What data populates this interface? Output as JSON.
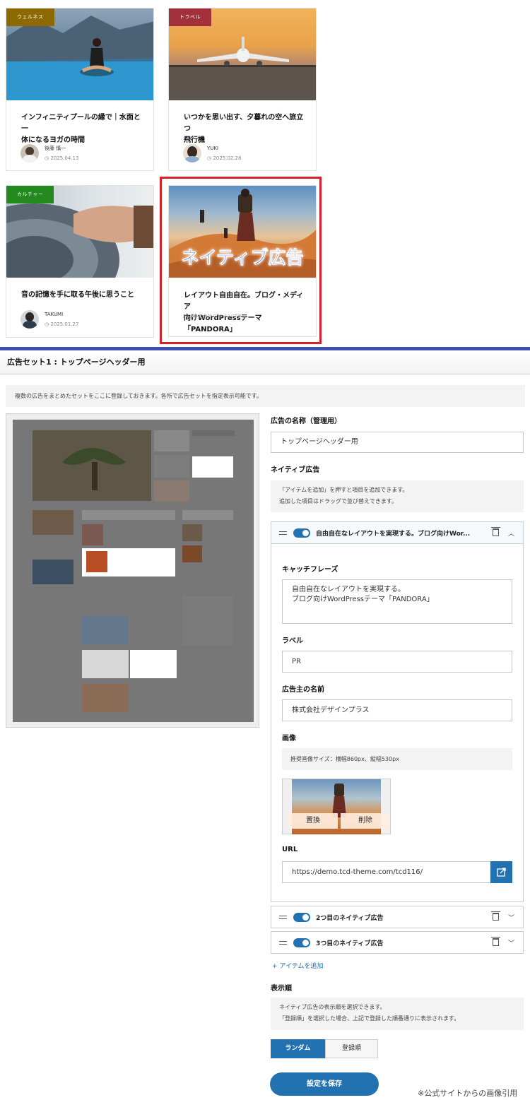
{
  "articles": [
    {
      "category": "ウェルネス",
      "category_color": "#8c6a00",
      "title_line1": "インフィニティプールの縁で｜水面と一",
      "title_line2": "体になるヨガの時間",
      "author": "後藤 慎一",
      "date": "2025.04.13"
    },
    {
      "category": "トラベル",
      "category_color": "#a3313c",
      "title_line1": "いつかを思い出す、夕暮れの空へ旅立つ",
      "title_line2": "飛行機",
      "author": "YUKI",
      "date": "2025.02.28"
    },
    {
      "category": "カルチャー",
      "category_color": "#23891f",
      "title_line1": "音の記憶を手に取る午後に思うこと",
      "title_line2": "",
      "author": "TAKUMI",
      "date": "2025.01.27"
    }
  ],
  "native_ad_card": {
    "overlay": "ネイティブ広告",
    "title_line1": "レイアウト自由自在。ブログ・メディア",
    "title_line2": "向けWordPressテーマ「PANDORA」",
    "label": "PR",
    "advertiser": "株式会社デザインプラス"
  },
  "admin": {
    "header": "広告セット1 : トップページヘッダー用",
    "description": "複数の広告をまとめたセットをここに登録しておきます。各所で広告セットを指定表示可能です。",
    "name_label": "広告の名称（管理用）",
    "name_value": "トップページヘッダー用",
    "native_label": "ネイティブ広告",
    "native_note_1": "「アイテムを追加」を押すと項目を追加できます。",
    "native_note_2": "追加した項目はドラッグで並び替えできます。",
    "item1_title": "自由自在なレイアウトを実現する。ブログ向けWor...",
    "catch_label": "キャッチフレーズ",
    "catch_line1": "自由自在なレイアウトを実現する。",
    "catch_line2": "ブログ向けWordPressテーマ「PANDORA」",
    "label_label": "ラベル",
    "label_value": "PR",
    "advertiser_label": "広告主の名前",
    "advertiser_value": "株式会社デザインプラス",
    "image_label": "画像",
    "image_note": "推奨画像サイズ：横幅860px、縦幅530px",
    "replace_btn": "置換",
    "delete_btn": "削除",
    "url_label": "URL",
    "url_value": "https://demo.tcd-theme.com/tcd116/",
    "item2_title": "2つ目のネイティブ広告",
    "item3_title": "3つ目のネイティブ広告",
    "add_item": "+ アイテムを追加",
    "order_label": "表示順",
    "order_note_1": "ネイティブ広告の表示順を選択できます。",
    "order_note_2": "「登録順」を選択した場合、上記で登録した順番通りに表示されます。",
    "order_random": "ランダム",
    "order_registered": "登録順",
    "save": "設定を保存"
  },
  "credit": "※公式サイトからの画像引用",
  "accent_color": "#2271b1"
}
